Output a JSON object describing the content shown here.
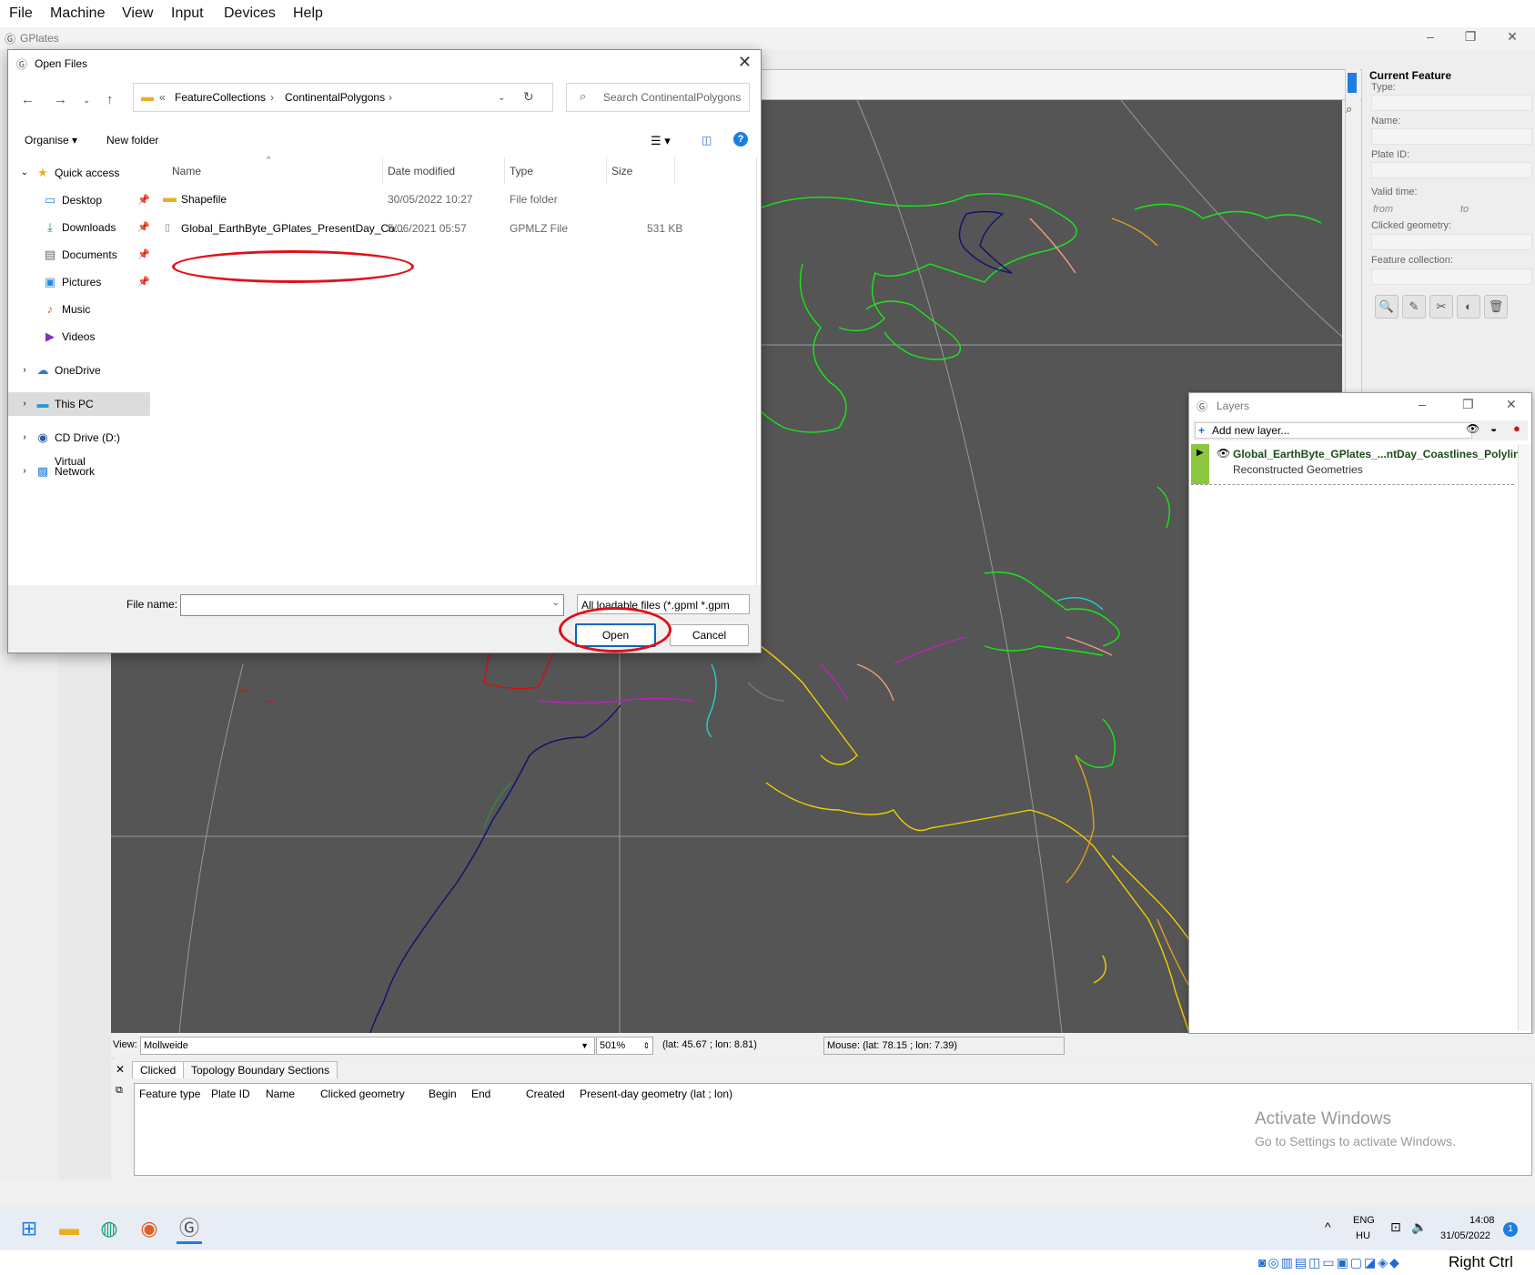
{
  "vm_menu": [
    "File",
    "Machine",
    "View",
    "Input",
    "Devices",
    "Help"
  ],
  "app": {
    "title": "GPlates",
    "window_controls": [
      "–",
      "❐",
      "✕"
    ]
  },
  "current_feature": {
    "heading": "Current Feature",
    "type_label": "Type:",
    "name_label": "Name:",
    "plate_label": "Plate ID:",
    "valid_time_label": "Valid time:",
    "from_label": "from",
    "to_label": "to",
    "clicked_geometry_label": "Clicked geometry:",
    "feature_collection_label": "Feature collection:"
  },
  "layers": {
    "title": "Layers",
    "add_layer": "Add new layer...",
    "layer_name": "Global_EarthByte_GPlates_...ntDay_Coastlines_Polyline",
    "layer_type": "Reconstructed Geometries"
  },
  "status": {
    "view_label": "View:",
    "projection": "Mollweide",
    "zoom": "501%",
    "camera": "(lat: 45.67 ; lon: 8.81)",
    "mouse": "Mouse: (lat: 78.15 ; lon: 7.39)"
  },
  "bottom_panel": {
    "tabs": [
      "Clicked",
      "Topology Boundary Sections"
    ],
    "columns": [
      "Feature type",
      "Plate ID",
      "Name",
      "Clicked geometry",
      "Begin",
      "End",
      "Created",
      "Present-day geometry (lat ; lon)"
    ]
  },
  "watermark": {
    "line1": "Activate Windows",
    "line2": "Go to Settings to activate Windows."
  },
  "dialog": {
    "title": "Open Files",
    "address": {
      "prefix": "«",
      "crumbs": [
        "FeatureCollections",
        "ContinentalPolygons"
      ]
    },
    "search_placeholder": "Search ContinentalPolygons",
    "organise": "Organise ▾",
    "new_folder": "New folder",
    "nav": [
      {
        "label": "Quick access",
        "icon": "star-icon"
      },
      {
        "label": "Desktop",
        "icon": "desktop-icon"
      },
      {
        "label": "Downloads",
        "icon": "download-icon"
      },
      {
        "label": "Documents",
        "icon": "documents-icon"
      },
      {
        "label": "Pictures",
        "icon": "pictures-icon"
      },
      {
        "label": "Music",
        "icon": "music-icon"
      },
      {
        "label": "Videos",
        "icon": "videos-icon"
      },
      {
        "label": "OneDrive",
        "icon": "cloud-icon"
      },
      {
        "label": "This PC",
        "icon": "computer-icon"
      },
      {
        "label": "CD Drive (D:) Virtual",
        "icon": "cd-icon"
      },
      {
        "label": "Network",
        "icon": "network-icon"
      }
    ],
    "columns": [
      "Name",
      "Date modified",
      "Type",
      "Size"
    ],
    "files": [
      {
        "name": "Shapefile",
        "date": "30/05/2022 10:27",
        "type": "File folder",
        "size": ""
      },
      {
        "name": "Global_EarthByte_GPlates_PresentDay_Co...",
        "date": "5/06/2021 05:57",
        "type": "GPMLZ File",
        "size": "531 KB"
      }
    ],
    "file_name_label": "File name:",
    "file_name_value": "",
    "file_type": "All loadable files (*.gpml *.gpm",
    "open_button": "Open",
    "cancel_button": "Cancel"
  },
  "tray": {
    "lang1": "ENG",
    "lang2": "HU",
    "time": "14:08",
    "date": "31/05/2022",
    "notification_count": "1",
    "host_key": "Right Ctrl"
  },
  "colors": {
    "map_bg": "#555555",
    "accent": "#0067c0",
    "annotation": "#e0101a",
    "layer_green": "#8cc63f"
  }
}
